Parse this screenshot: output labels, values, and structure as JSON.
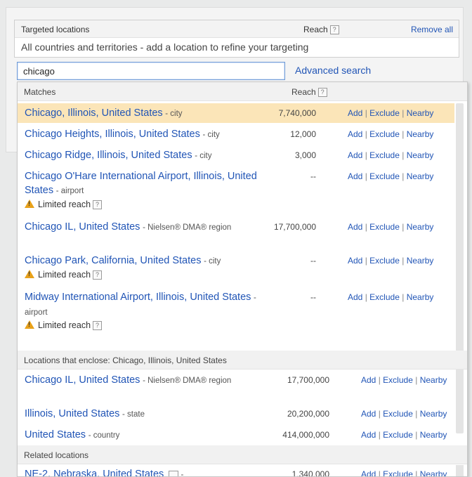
{
  "targeted": {
    "title": "Targeted locations",
    "reach_label": "Reach",
    "help": "?",
    "remove_all": "Remove all",
    "body": "All countries and territories - add a location to refine your targeting"
  },
  "search": {
    "value": "chicago",
    "advanced": "Advanced search"
  },
  "matches": {
    "header": "Matches",
    "reach_label": "Reach",
    "rows": [
      {
        "name": "Chicago, Illinois, United States",
        "type": "- city",
        "reach": "7,740,000"
      },
      {
        "name": "Chicago Heights, Illinois, United States",
        "type": "- city",
        "reach": "12,000"
      },
      {
        "name": "Chicago Ridge, Illinois, United States",
        "type": "- city",
        "reach": "3,000"
      },
      {
        "name": "Chicago O'Hare International Airport, Illinois, United States",
        "type": "- airport",
        "reach": "--",
        "limited": "Limited reach"
      },
      {
        "name": "Chicago IL, United States",
        "type": "- Nielsen® DMA® region",
        "reach": "17,700,000"
      },
      {
        "name": "Chicago Park, California, United States",
        "type": "- city",
        "reach": "--",
        "limited": "Limited reach"
      },
      {
        "name": "Midway International Airport, Illinois, United States",
        "type": "- airport",
        "reach": "--",
        "limited": "Limited reach"
      }
    ]
  },
  "enclose": {
    "header": "Locations that enclose: Chicago, Illinois, United States",
    "rows": [
      {
        "name": "Chicago IL, United States",
        "type": "- Nielsen® DMA® region",
        "reach": "17,700,000"
      },
      {
        "name": "Illinois, United States",
        "type": "- state",
        "reach": "20,200,000"
      },
      {
        "name": "United States",
        "type": "- country",
        "reach": "414,000,000"
      }
    ]
  },
  "related": {
    "header": "Related locations",
    "rows": [
      {
        "name": "NE-2, Nebraska, United States",
        "type": "-",
        "reach": "1,340,000"
      }
    ]
  },
  "actions": {
    "add": "Add",
    "exclude": "Exclude",
    "nearby": "Nearby",
    "sep": "|"
  },
  "colors": {
    "link": "#2155b6",
    "selected_row": "#fbe5b8",
    "warning": "#e8a11a"
  }
}
